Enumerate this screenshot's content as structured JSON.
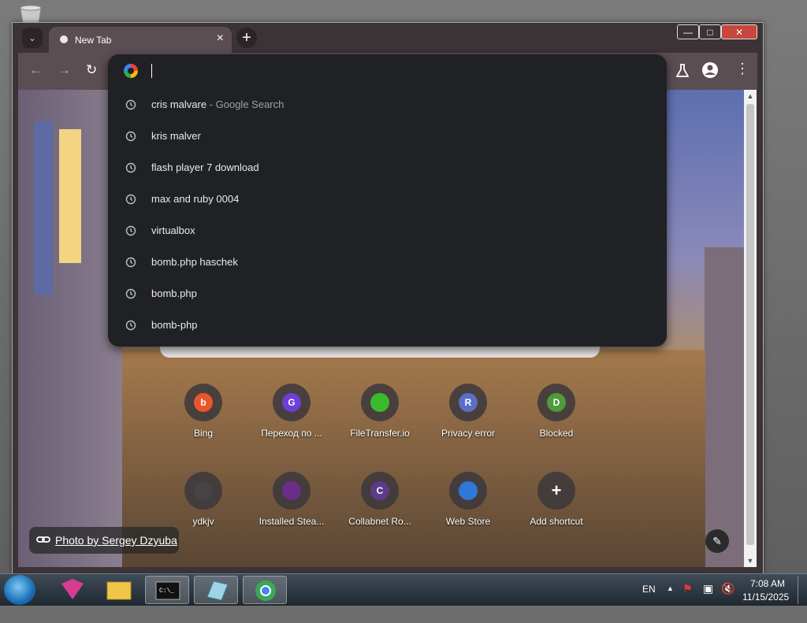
{
  "browser": {
    "tab_title": "New Tab",
    "omnibox_value": "",
    "suggestions": [
      {
        "text": "cris malvare",
        "suffix": " - Google Search"
      },
      {
        "text": "kris malver",
        "suffix": ""
      },
      {
        "text": "flash player 7 download",
        "suffix": ""
      },
      {
        "text": "max and ruby 0004",
        "suffix": ""
      },
      {
        "text": "virtualbox",
        "suffix": ""
      },
      {
        "text": "bomb.php haschek",
        "suffix": ""
      },
      {
        "text": "bomb.php",
        "suffix": ""
      },
      {
        "text": "bomb-php",
        "suffix": ""
      }
    ]
  },
  "shortcuts": [
    {
      "name": "Bing",
      "letter": "b",
      "icon": "bing-icon",
      "color": "#e8562a"
    },
    {
      "name": "Переход по ...",
      "letter": "G",
      "icon": "letter-g-icon",
      "color": "#6b3fd8"
    },
    {
      "name": "FileTransfer.io",
      "letter": "",
      "icon": "filetransfer-icon",
      "color": "#3cba2d"
    },
    {
      "name": "Privacy error",
      "letter": "R",
      "icon": "letter-r-icon",
      "color": "#5a6fc4"
    },
    {
      "name": "Blocked",
      "letter": "D",
      "icon": "letter-d-icon",
      "color": "#4f9a3a"
    },
    {
      "name": "ydkjv",
      "letter": "",
      "icon": "building-icon",
      "color": "#444444"
    },
    {
      "name": "Installed Stea...",
      "letter": "",
      "icon": "steam-icon",
      "color": "#6a2d8a"
    },
    {
      "name": "Collabnet Ro...",
      "letter": "C",
      "icon": "letter-c-icon",
      "color": "#5a3b8c"
    },
    {
      "name": "Web Store",
      "letter": "",
      "icon": "web-store-icon",
      "color": "#2f78d8"
    },
    {
      "name": "Add shortcut",
      "letter": "+",
      "icon": "add-icon",
      "color": "#3c373c"
    }
  ],
  "photo_credit": "Photo by Sergey Dzyuba",
  "taskbar": {
    "language": "EN",
    "time": "7:08 AM",
    "date": "11/15/2025"
  }
}
